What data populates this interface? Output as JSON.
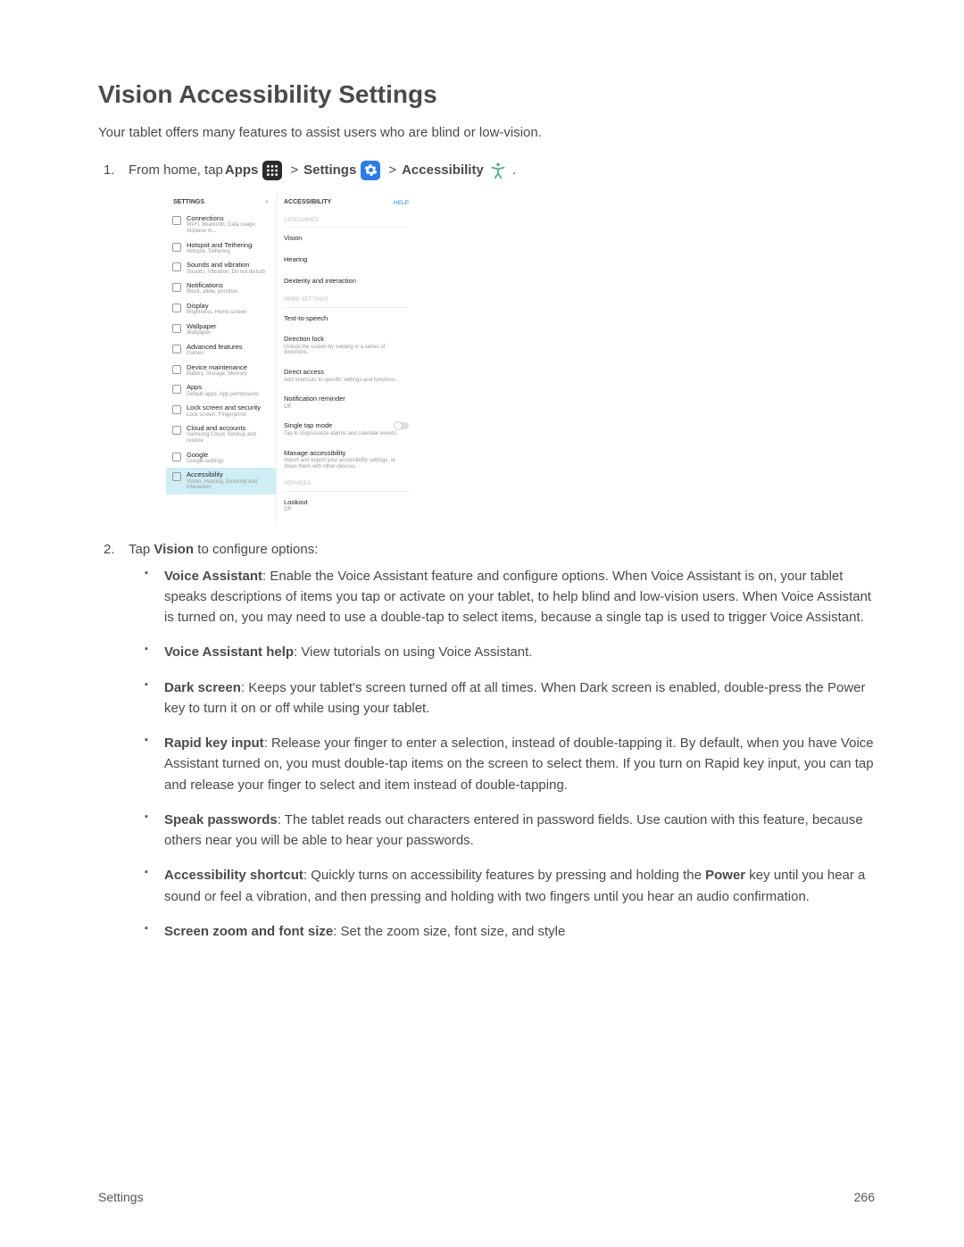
{
  "heading": "Vision Accessibility Settings",
  "intro": "Your tablet offers many features to assist users who are blind or low-vision.",
  "step1": {
    "pre": "From home, tap ",
    "apps": "Apps",
    "sep": " > ",
    "settings": "Settings",
    "accessibility": "Accessibility",
    "period": "."
  },
  "shot": {
    "left_title": "SETTINGS",
    "search_glyph": "⌕",
    "right_title": "ACCESSIBILITY",
    "help": "HELP",
    "cat_label": "CATEGORIES",
    "more_label": "MORE SETTINGS",
    "services_label": "SERVICES",
    "left": [
      {
        "t": "Connections",
        "s": "Wi-Fi, Bluetooth, Data usage, Airplane m..."
      },
      {
        "t": "Hotspot and Tethering",
        "s": "Hotspot, Tethering"
      },
      {
        "t": "Sounds and vibration",
        "s": "Sounds, Vibration, Do not disturb"
      },
      {
        "t": "Notifications",
        "s": "Block, allow, prioritize"
      },
      {
        "t": "Display",
        "s": "Brightness, Home screen"
      },
      {
        "t": "Wallpaper",
        "s": "Wallpaper"
      },
      {
        "t": "Advanced features",
        "s": "Games"
      },
      {
        "t": "Device maintenance",
        "s": "Battery, Storage, Memory"
      },
      {
        "t": "Apps",
        "s": "Default apps, App permissions"
      },
      {
        "t": "Lock screen and security",
        "s": "Lock screen, Fingerprints"
      },
      {
        "t": "Cloud and accounts",
        "s": "Samsung Cloud, Backup and restore"
      },
      {
        "t": "Google",
        "s": "Google settings"
      },
      {
        "t": "Accessibility",
        "s": "Vision, Hearing, Dexterity and interaction"
      }
    ],
    "right_cat": [
      "Vision",
      "Hearing",
      "Dexterity and interaction"
    ],
    "right_more": [
      {
        "t": "Text-to-speech",
        "s": ""
      },
      {
        "t": "Direction lock",
        "s": "Unlock the screen by swiping in a series of directions."
      },
      {
        "t": "Direct access",
        "s": "Add shortcuts to specific settings and functions."
      },
      {
        "t": "Notification reminder",
        "s": "Off"
      },
      {
        "t": "Single tap mode",
        "s": "Tap to stop/snooze alarms and calendar events.",
        "toggle": true
      },
      {
        "t": "Manage accessibility",
        "s": "Import and export your accessibility settings, or share them with other devices."
      }
    ],
    "right_services": [
      {
        "t": "Lookout",
        "s": "Off"
      }
    ]
  },
  "step2": {
    "pre": "Tap ",
    "bold": "Vision",
    "post": " to configure options:"
  },
  "options": [
    {
      "title": "Voice Assistant",
      "body": ": Enable the Voice Assistant feature and configure options. When Voice Assistant is on, your tablet speaks descriptions of items you tap or activate on your tablet, to help blind and low-vision users. When Voice Assistant is turned on, you may need to use a double-tap to select items, because a single tap is used to trigger Voice Assistant."
    },
    {
      "title": "Voice Assistant help",
      "body": ": View tutorials on using Voice Assistant."
    },
    {
      "title": "Dark screen",
      "body": ": Keeps your tablet's screen turned off at all times. When Dark screen is enabled, double-press the Power key to turn it on or off while using your tablet."
    },
    {
      "title": "Rapid key input",
      "body": ": Release your finger to enter a selection, instead of double-tapping it. By default, when you have Voice Assistant turned on, you must double-tap items on the screen to select them. If you turn on Rapid key input, you can tap and release your finger to select and item instead of double-tapping."
    },
    {
      "title": "Speak passwords",
      "body": ": The tablet reads out characters entered in password fields. Use caution with this feature, because others near you will be able to hear your passwords."
    },
    {
      "title": "Accessibility shortcut",
      "body_pre": ": Quickly turns on accessibility features by pressing and holding the ",
      "power": "Power",
      "body_post": " key until you hear a sound or feel a vibration, and then pressing and holding with two fingers until you hear an audio confirmation."
    },
    {
      "title": "Screen zoom and font size",
      "body": ": Set the zoom size, font size, and style"
    }
  ],
  "footer": {
    "section": "Settings",
    "page": "266"
  }
}
